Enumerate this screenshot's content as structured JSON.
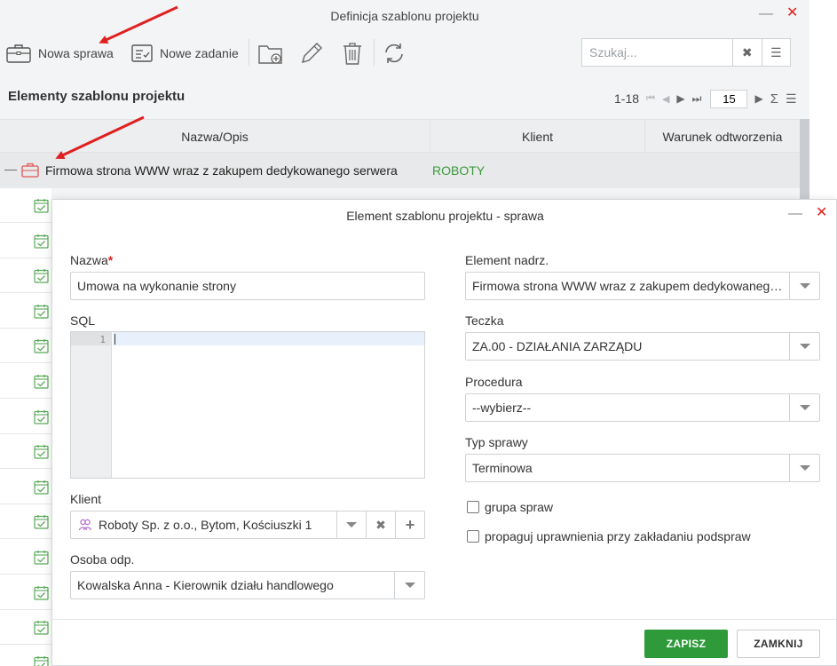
{
  "back_window": {
    "title": "Definicja szablonu projektu",
    "toolbar": {
      "new_case_label": "Nowa sprawa",
      "new_task_label": "Nowe zadanie"
    },
    "search": {
      "placeholder": "Szukaj..."
    },
    "section_title": "Elementy szablonu projektu",
    "pager": {
      "range": "1-18",
      "page_size": "15"
    },
    "grid": {
      "columns": [
        "Nazwa/Opis",
        "Klient",
        "Warunek odtworzenia"
      ],
      "main_row": {
        "name": "Firmowa strona WWW wraz z zakupem dedykowanego serwera",
        "client": "ROBOTY"
      },
      "task_row_count": 14
    }
  },
  "modal": {
    "title": "Element szablonu projektu - sprawa",
    "fields": {
      "name_label": "Nazwa",
      "name_required_mark": "*",
      "name_value": "Umowa na wykonanie strony",
      "sql_label": "SQL",
      "sql_line_number": "1",
      "client_label": "Klient",
      "client_value": "Roboty Sp. z o.o., Bytom, Kościuszki 1",
      "person_label": "Osoba odp.",
      "person_value": "Kowalska Anna - Kierownik działu handlowego",
      "parent_label": "Element nadrz.",
      "parent_value": "Firmowa strona WWW wraz z zakupem dedykowanego serwera",
      "folder_label": "Teczka",
      "folder_value": "ZA.00 - DZIAŁANIA ZARZĄDU",
      "procedure_label": "Procedura",
      "procedure_value": "--wybierz--",
      "case_type_label": "Typ sprawy",
      "case_type_value": "Terminowa",
      "group_label": "grupa spraw",
      "propagate_label": "propaguj uprawnienia przy zakładaniu podspraw"
    },
    "buttons": {
      "save": "ZAPISZ",
      "close": "ZAMKNIJ"
    }
  },
  "colors": {
    "accent_green": "#2e9a3a",
    "close_red": "#e02020",
    "annotation_red": "#e02020"
  }
}
